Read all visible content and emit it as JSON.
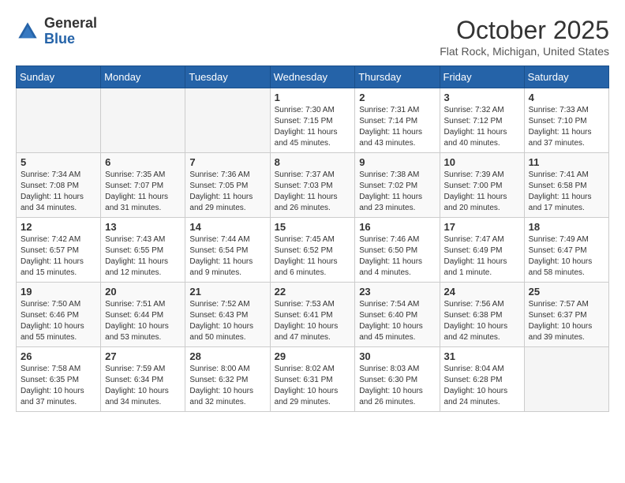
{
  "logo": {
    "general": "General",
    "blue": "Blue"
  },
  "title": "October 2025",
  "location": "Flat Rock, Michigan, United States",
  "weekdays": [
    "Sunday",
    "Monday",
    "Tuesday",
    "Wednesday",
    "Thursday",
    "Friday",
    "Saturday"
  ],
  "weeks": [
    [
      {
        "day": "",
        "info": ""
      },
      {
        "day": "",
        "info": ""
      },
      {
        "day": "",
        "info": ""
      },
      {
        "day": "1",
        "info": "Sunrise: 7:30 AM\nSunset: 7:15 PM\nDaylight: 11 hours\nand 45 minutes."
      },
      {
        "day": "2",
        "info": "Sunrise: 7:31 AM\nSunset: 7:14 PM\nDaylight: 11 hours\nand 43 minutes."
      },
      {
        "day": "3",
        "info": "Sunrise: 7:32 AM\nSunset: 7:12 PM\nDaylight: 11 hours\nand 40 minutes."
      },
      {
        "day": "4",
        "info": "Sunrise: 7:33 AM\nSunset: 7:10 PM\nDaylight: 11 hours\nand 37 minutes."
      }
    ],
    [
      {
        "day": "5",
        "info": "Sunrise: 7:34 AM\nSunset: 7:08 PM\nDaylight: 11 hours\nand 34 minutes."
      },
      {
        "day": "6",
        "info": "Sunrise: 7:35 AM\nSunset: 7:07 PM\nDaylight: 11 hours\nand 31 minutes."
      },
      {
        "day": "7",
        "info": "Sunrise: 7:36 AM\nSunset: 7:05 PM\nDaylight: 11 hours\nand 29 minutes."
      },
      {
        "day": "8",
        "info": "Sunrise: 7:37 AM\nSunset: 7:03 PM\nDaylight: 11 hours\nand 26 minutes."
      },
      {
        "day": "9",
        "info": "Sunrise: 7:38 AM\nSunset: 7:02 PM\nDaylight: 11 hours\nand 23 minutes."
      },
      {
        "day": "10",
        "info": "Sunrise: 7:39 AM\nSunset: 7:00 PM\nDaylight: 11 hours\nand 20 minutes."
      },
      {
        "day": "11",
        "info": "Sunrise: 7:41 AM\nSunset: 6:58 PM\nDaylight: 11 hours\nand 17 minutes."
      }
    ],
    [
      {
        "day": "12",
        "info": "Sunrise: 7:42 AM\nSunset: 6:57 PM\nDaylight: 11 hours\nand 15 minutes."
      },
      {
        "day": "13",
        "info": "Sunrise: 7:43 AM\nSunset: 6:55 PM\nDaylight: 11 hours\nand 12 minutes."
      },
      {
        "day": "14",
        "info": "Sunrise: 7:44 AM\nSunset: 6:54 PM\nDaylight: 11 hours\nand 9 minutes."
      },
      {
        "day": "15",
        "info": "Sunrise: 7:45 AM\nSunset: 6:52 PM\nDaylight: 11 hours\nand 6 minutes."
      },
      {
        "day": "16",
        "info": "Sunrise: 7:46 AM\nSunset: 6:50 PM\nDaylight: 11 hours\nand 4 minutes."
      },
      {
        "day": "17",
        "info": "Sunrise: 7:47 AM\nSunset: 6:49 PM\nDaylight: 11 hours\nand 1 minute."
      },
      {
        "day": "18",
        "info": "Sunrise: 7:49 AM\nSunset: 6:47 PM\nDaylight: 10 hours\nand 58 minutes."
      }
    ],
    [
      {
        "day": "19",
        "info": "Sunrise: 7:50 AM\nSunset: 6:46 PM\nDaylight: 10 hours\nand 55 minutes."
      },
      {
        "day": "20",
        "info": "Sunrise: 7:51 AM\nSunset: 6:44 PM\nDaylight: 10 hours\nand 53 minutes."
      },
      {
        "day": "21",
        "info": "Sunrise: 7:52 AM\nSunset: 6:43 PM\nDaylight: 10 hours\nand 50 minutes."
      },
      {
        "day": "22",
        "info": "Sunrise: 7:53 AM\nSunset: 6:41 PM\nDaylight: 10 hours\nand 47 minutes."
      },
      {
        "day": "23",
        "info": "Sunrise: 7:54 AM\nSunset: 6:40 PM\nDaylight: 10 hours\nand 45 minutes."
      },
      {
        "day": "24",
        "info": "Sunrise: 7:56 AM\nSunset: 6:38 PM\nDaylight: 10 hours\nand 42 minutes."
      },
      {
        "day": "25",
        "info": "Sunrise: 7:57 AM\nSunset: 6:37 PM\nDaylight: 10 hours\nand 39 minutes."
      }
    ],
    [
      {
        "day": "26",
        "info": "Sunrise: 7:58 AM\nSunset: 6:35 PM\nDaylight: 10 hours\nand 37 minutes."
      },
      {
        "day": "27",
        "info": "Sunrise: 7:59 AM\nSunset: 6:34 PM\nDaylight: 10 hours\nand 34 minutes."
      },
      {
        "day": "28",
        "info": "Sunrise: 8:00 AM\nSunset: 6:32 PM\nDaylight: 10 hours\nand 32 minutes."
      },
      {
        "day": "29",
        "info": "Sunrise: 8:02 AM\nSunset: 6:31 PM\nDaylight: 10 hours\nand 29 minutes."
      },
      {
        "day": "30",
        "info": "Sunrise: 8:03 AM\nSunset: 6:30 PM\nDaylight: 10 hours\nand 26 minutes."
      },
      {
        "day": "31",
        "info": "Sunrise: 8:04 AM\nSunset: 6:28 PM\nDaylight: 10 hours\nand 24 minutes."
      },
      {
        "day": "",
        "info": ""
      }
    ]
  ]
}
